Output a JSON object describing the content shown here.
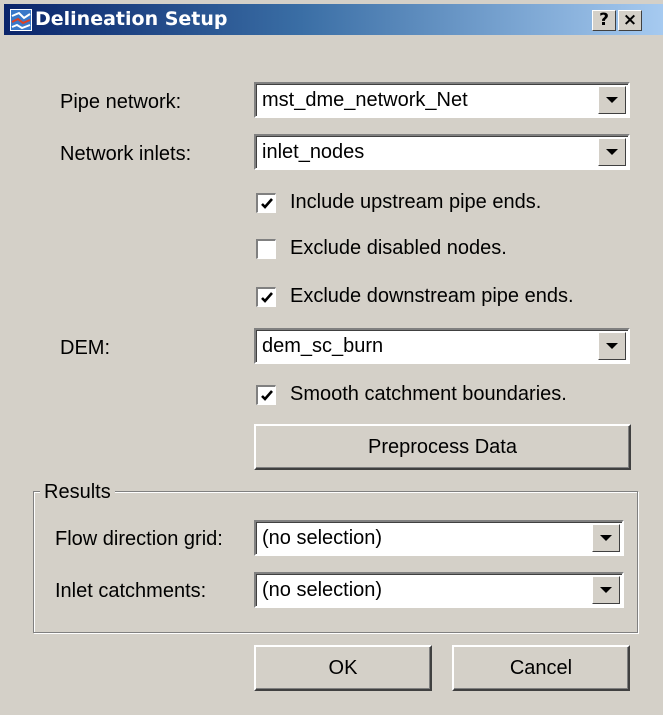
{
  "window": {
    "title": "Delineation Setup",
    "help_label": "?",
    "close_label": "×"
  },
  "pipe_network": {
    "label": "Pipe network:",
    "value": "mst_dme_network_Net"
  },
  "network_inlets": {
    "label": "Network inlets:",
    "value": "inlet_nodes"
  },
  "options": [
    {
      "label": "Include upstream pipe ends.",
      "checked": true
    },
    {
      "label": "Exclude disabled nodes.",
      "checked": false
    },
    {
      "label": "Exclude downstream pipe ends.",
      "checked": true
    }
  ],
  "dem": {
    "label": "DEM:",
    "value": "dem_sc_burn"
  },
  "smooth": {
    "label": "Smooth catchment boundaries.",
    "checked": true
  },
  "preprocess_label": "Preprocess Data",
  "results": {
    "title": "Results",
    "flow_direction": {
      "label": "Flow direction grid:",
      "value": "(no selection)"
    },
    "inlet_catchments": {
      "label": "Inlet catchments:",
      "value": "(no selection)"
    }
  },
  "ok_label": "OK",
  "cancel_label": "Cancel",
  "colors": {
    "titlebar_start": "#0a246a",
    "titlebar_end": "#a6caf0",
    "face": "#d4d0c8"
  }
}
